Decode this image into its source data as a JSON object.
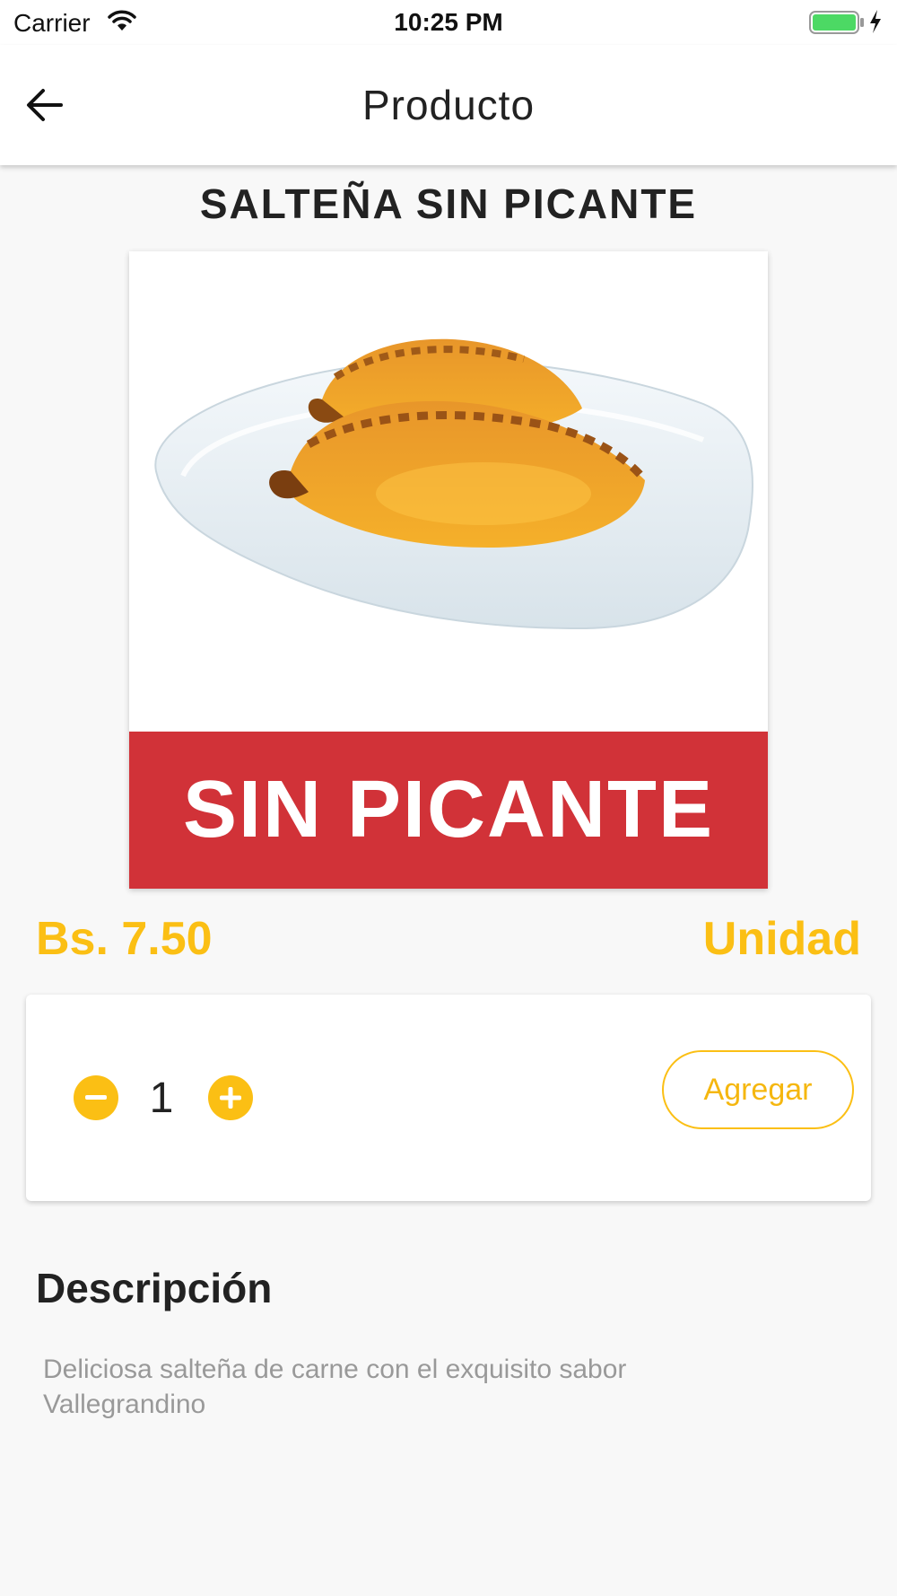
{
  "status_bar": {
    "carrier": "Carrier",
    "time": "10:25 PM",
    "battery_color": "#4cd964"
  },
  "app_bar": {
    "title": "Producto",
    "back_icon": "arrow-left-icon"
  },
  "product": {
    "name": "SALTEÑA SIN PICANTE",
    "image_banner_text": "SIN PICANTE",
    "banner_color": "#d13238",
    "price": "Bs. 7.50",
    "unit": "Unidad"
  },
  "order": {
    "quantity": "1",
    "minus_icon": "minus-circle-icon",
    "plus_icon": "plus-circle-icon",
    "add_label": "Agregar"
  },
  "description": {
    "title": "Descripción",
    "text": "Deliciosa salteña de carne con el exquisito sabor Vallegrandino"
  },
  "colors": {
    "accent": "#fbbf14",
    "background": "#f8f8f8"
  }
}
